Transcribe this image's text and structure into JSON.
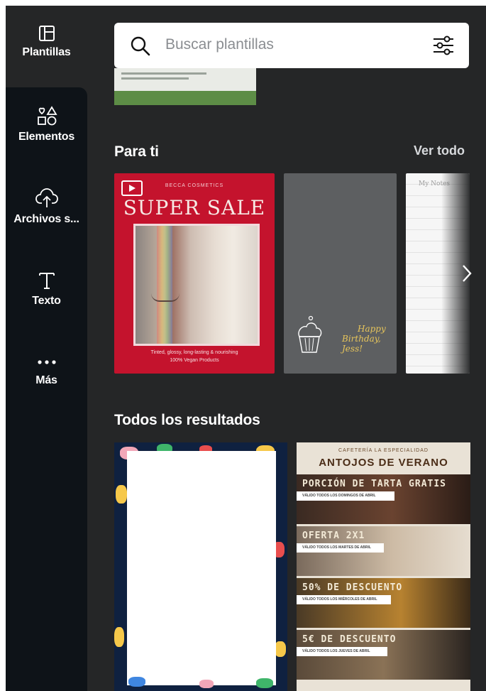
{
  "sidebar": {
    "items": [
      {
        "label": "Plantillas",
        "icon": "template-icon",
        "active": true
      },
      {
        "label": "Elementos",
        "icon": "shapes-icon",
        "active": false
      },
      {
        "label": "Archivos s...",
        "icon": "cloud-upload-icon",
        "active": false
      },
      {
        "label": "Texto",
        "icon": "text-icon",
        "active": false
      },
      {
        "label": "Más",
        "icon": "more-dots-icon",
        "active": false
      }
    ]
  },
  "search": {
    "placeholder": "Buscar plantillas",
    "icon": "search-icon",
    "filter_icon": "filter-sliders-icon"
  },
  "para_ti": {
    "title": "Para ti",
    "see_all": "Ver todo",
    "cards": [
      {
        "name": "super-sale",
        "brand": "BECCA COSMETICS",
        "headline": "SUPER SALE",
        "footer_lines": [
          "Tinted, glossy, long-lasting & nourishing",
          "100% Vegan Products"
        ],
        "badge_icon": "video-play-icon"
      },
      {
        "name": "birthday",
        "text_lines": [
          "Happy",
          "Birthday, Jess!"
        ],
        "icon": "cupcake-icon"
      },
      {
        "name": "notes",
        "title": "My Notes"
      }
    ]
  },
  "results": {
    "title": "Todos los resultados",
    "cafe": {
      "subtitle": "CAFETERÍA LA ESPECIALIDAD",
      "title": "ANTOJOS DE VERANO",
      "rows": [
        {
          "label": "PORCIÓN DE TARTA GRATIS",
          "tag": "VÁLIDO TODOS LOS DOMINGOS DE ABRIL"
        },
        {
          "label": "OFERTA 2X1",
          "tag": "VÁLIDO TODOS LOS MARTES DE ABRIL"
        },
        {
          "label": "50% DE DESCUENTO",
          "tag": "VÁLIDO TODOS LOS MIÉRCOLES DE ABRIL"
        },
        {
          "label": "5€ DE DESCUENTO",
          "tag": "VÁLIDO TODOS LOS JUEVES DE ABRIL"
        }
      ]
    }
  },
  "colors": {
    "sidebar_bg": "#0e1318",
    "panel_bg": "#252627",
    "sale_red": "#c4132d"
  }
}
